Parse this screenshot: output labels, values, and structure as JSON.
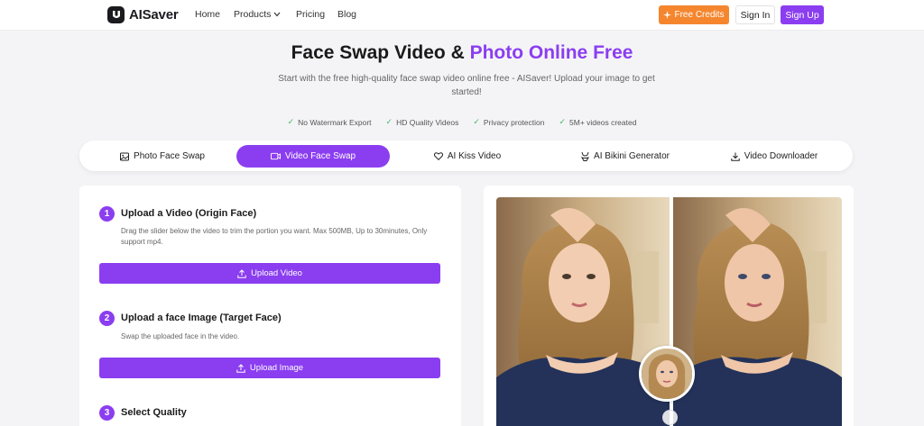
{
  "nav": {
    "brand": "AISaver",
    "links": [
      "Home",
      "Products",
      "Pricing",
      "Blog"
    ],
    "free_credits": "Free Credits",
    "sign_in": "Sign In",
    "sign_up": "Sign Up"
  },
  "hero": {
    "title_main": "Face Swap Video & ",
    "title_accent": "Photo Online Free",
    "subtitle": "Start with the free high-quality face swap video online free - AISaver! Upload your image to get started!",
    "features": [
      "No Watermark Export",
      "HD Quality Videos",
      "Privacy protection",
      "5M+ videos created"
    ]
  },
  "tabs": [
    {
      "label": "Photo Face Swap",
      "icon": "image-icon",
      "active": false
    },
    {
      "label": "Video Face Swap",
      "icon": "video-icon",
      "active": true
    },
    {
      "label": "AI Kiss Video",
      "icon": "heart-icon",
      "active": false
    },
    {
      "label": "AI Bikini Generator",
      "icon": "bikini-icon",
      "active": false
    },
    {
      "label": "Video Downloader",
      "icon": "download-icon",
      "active": false
    }
  ],
  "steps": [
    {
      "num": "1",
      "title": "Upload a Video (Origin Face)",
      "desc": "Drag the slider below the video to trim the portion you want. Max 500MB, Up to 30minutes, Only support mp4.",
      "button": "Upload Video"
    },
    {
      "num": "2",
      "title": "Upload a face Image (Target Face)",
      "desc": "Swap the uploaded face in the video.",
      "button": "Upload Image"
    },
    {
      "num": "3",
      "title": "Select Quality"
    }
  ],
  "colors": {
    "brand_purple": "#8b3ef0",
    "credits_orange": "#f5862e",
    "check_green": "#3cba6a"
  }
}
